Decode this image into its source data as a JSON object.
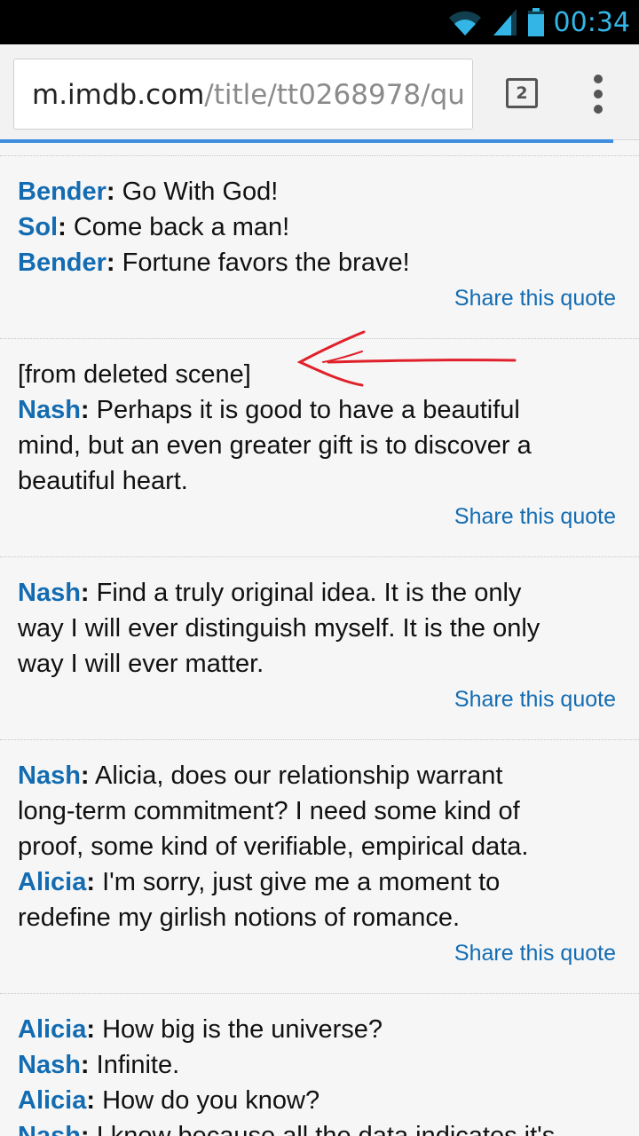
{
  "status_bar": {
    "time": "00:34",
    "icons": [
      "wifi-icon",
      "signal-icon",
      "battery-icon"
    ],
    "accent_color": "#33b5e5"
  },
  "browser": {
    "url_host": "m.imdb.com",
    "url_path": "/title/tt0268978/qu",
    "tab_count": "2",
    "progress": 0.96
  },
  "quotes": [
    {
      "lines": [
        {
          "speaker": "Bender",
          "text": " Go With God!"
        },
        {
          "speaker": "Sol",
          "text": " Come back a man!"
        },
        {
          "speaker": "Bender",
          "text": " Fortune favors the brave!"
        }
      ],
      "share_label": "Share this quote"
    },
    {
      "note": "[from deleted scene]",
      "lines": [
        {
          "speaker": "Nash",
          "text": " Perhaps it is good to have a beautiful",
          "cont": [
            "mind, but an even greater gift is to discover a",
            "beautiful heart."
          ]
        }
      ],
      "share_label": "Share this quote"
    },
    {
      "lines": [
        {
          "speaker": "Nash",
          "text": " Find a truly original idea. It is the only",
          "cont": [
            "way I will ever distinguish myself. It is the only",
            "way I will ever matter."
          ]
        }
      ],
      "share_label": "Share this quote"
    },
    {
      "lines": [
        {
          "speaker": "Nash",
          "text": " Alicia, does our relationship warrant",
          "cont": [
            "long-term commitment? I need some kind of",
            "proof, some kind of verifiable, empirical data."
          ]
        },
        {
          "speaker": "Alicia",
          "text": " I'm sorry, just give me a moment to",
          "cont": [
            "redefine my girlish notions of romance."
          ]
        }
      ],
      "share_label": "Share this quote"
    },
    {
      "lines": [
        {
          "speaker": "Alicia",
          "text": " How big is the universe?"
        },
        {
          "speaker": "Nash",
          "text": " Infinite."
        },
        {
          "speaker": "Alicia",
          "text": " How do you know?"
        },
        {
          "speaker": "Nash",
          "text": " I know because all the data indicates it's"
        }
      ]
    }
  ],
  "colors": {
    "speaker": "#136cb2",
    "annotation_arrow": "#e0212b"
  }
}
